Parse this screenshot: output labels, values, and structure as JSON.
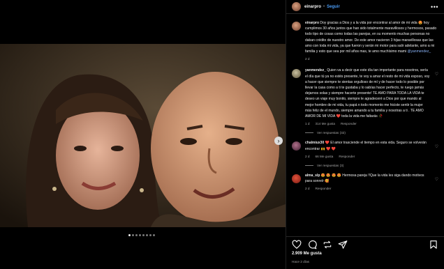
{
  "header": {
    "username": "einarpro",
    "separator": "•",
    "follow_label": "Seguir",
    "more_icon": "more-icon"
  },
  "caption": {
    "username": "einarpro",
    "text": "Doy gracias a Dios y a la vida por encontrar al amor de mi vida 😍 hoy cumplimos 30 años juntos que han sido totalmente maravillosos y hermosos, pasado todo tipo de cosas como todas las parejas, en su momento muchas personas no daban crédito de nuestro amor. De este amor nacieron 3 hijas maravillosas que las amo con toda mi vida, ya que fueron y serán mi motor para salir adelante, amo a mi familia y esto que sea por mil años mas, te amo muchísimo mami",
    "mention": "@yanmendez_",
    "time": "2 d"
  },
  "comments": [
    {
      "username": "yanmendez_",
      "text": "Quien va a decir que este día tan importante para nosotros, sería el día que tú ya no estés presente, te voy a amar el resto de mi vida esposo, voy a hacer que siempre te sientas orgulloso de mí y de hacer todo lo posible por llevar la casa como a ti te gustaba y lo sabías hacer perfecto, te ruego jamás dejarnos solas y siempre hacerte presente! TE AMO PARA TODA LA VIDA te deseo un viaje muy bonito, siempre le agradeceré a Dios por que mando al mejor hombre de mi vida, tu papá n todo momento me hiciste sentir la mujer más feliz de el mundo, siempre amando a tu familia y nosotras a ti . TE AMO AMOR DE MI VIDA ❤️ toda la vida me faltarás 🥀",
      "time": "1 d",
      "likes": "314 Me gusta",
      "reply": "Responder",
      "replies": "Ver respuestas (32)"
    },
    {
      "username": "chalmiux30",
      "text": "❤️ El amor trasciende el tiempo en esta vida. Seguro se volverán encontrar 🙌 ❤️ ❤️",
      "time": "2 d",
      "likes": "66 Me gusta",
      "reply": "Responder",
      "replies": "Ver respuestas (3)"
    },
    {
      "username": "alma_slp",
      "text": "😍 😍 😍 😍 Hermosa pareja !!Que la vida les siga dando motivos para sonreír 🥰",
      "time": "2 d",
      "likes": "",
      "reply": "Responder",
      "replies": ""
    }
  ],
  "actions": {
    "like_icon": "heart-icon",
    "comment_icon": "comment-icon",
    "repost_icon": "repost-icon",
    "share_icon": "share-icon",
    "save_icon": "bookmark-icon"
  },
  "stats": {
    "likes": "2.909 Me gusta",
    "time": "Hace 2 días"
  },
  "carousel": {
    "count": 8,
    "active": 1
  }
}
